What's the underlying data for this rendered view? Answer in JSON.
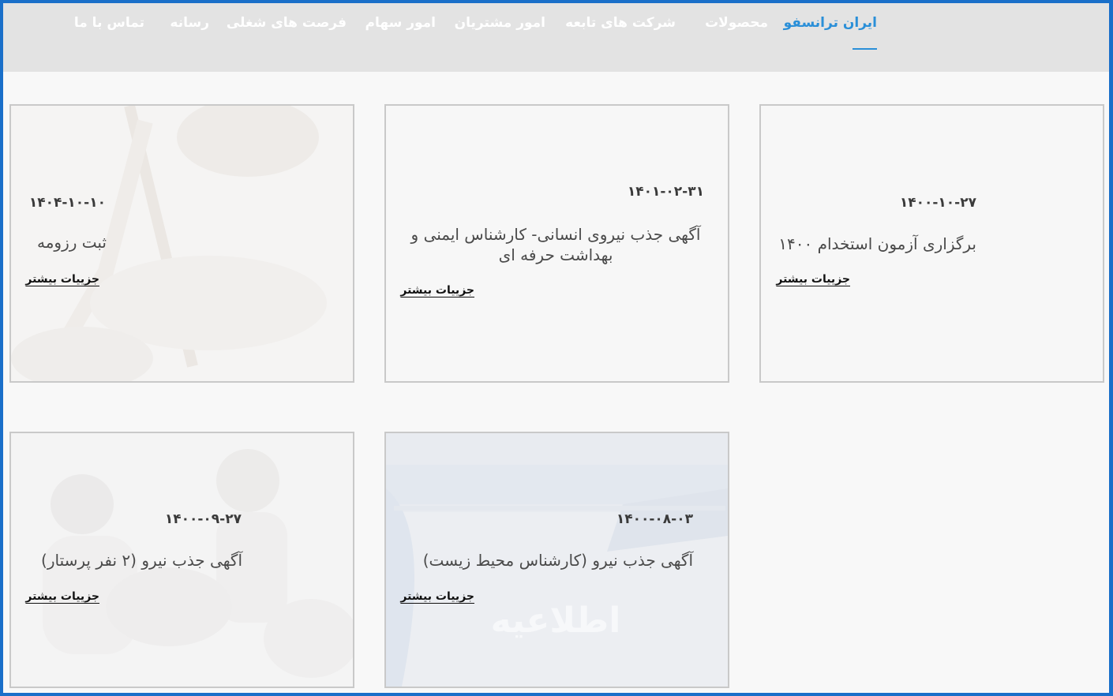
{
  "nav": {
    "items": [
      {
        "label": "ایران ترانسفو",
        "active": true
      },
      {
        "label": "محصولات"
      },
      {
        "label": "شرکت های تابعه"
      },
      {
        "label": "امور مشتریان"
      },
      {
        "label": "امور سهام"
      },
      {
        "label": "فرصت های شغلی"
      },
      {
        "label": "رسانه"
      },
      {
        "label": "تماس با ما"
      }
    ]
  },
  "colors": {
    "frame": "#1a6fc9",
    "accent": "#2a8fd8",
    "nav_bg": "#e3e3e3"
  },
  "cards": [
    {
      "date": "۱۴۰۴-۱۰-۱۰",
      "title": "ثبت رزومه",
      "link": "جزییات بیشتر",
      "background": "hands-writing-image"
    },
    {
      "date": "۱۴۰۱-۰۲-۳۱",
      "title": "آگهی جذب نیروی انسانی- کارشناس ایمنی و بهداشت حرفه ای",
      "link": "جزییات بیشتر"
    },
    {
      "date": "۱۴۰۰-۱۰-۲۷",
      "title": "برگزاری آزمون استخدام ۱۴۰۰",
      "link": "جزییات بیشتر"
    },
    {
      "date": "۱۴۰۰-۰۹-۲۷",
      "title": "آگهی جذب نیرو (۲ نفر پرستار)",
      "link": "جزییات بیشتر",
      "background": "nurses-image"
    },
    {
      "date": "۱۴۰۰-۰۸-۰۳",
      "title": "آگهی جذب نیرو (کارشناس محیط زیست)",
      "link": "جزییات بیشتر",
      "background": "announcement-image",
      "background_text": "اطلاعیه"
    }
  ]
}
